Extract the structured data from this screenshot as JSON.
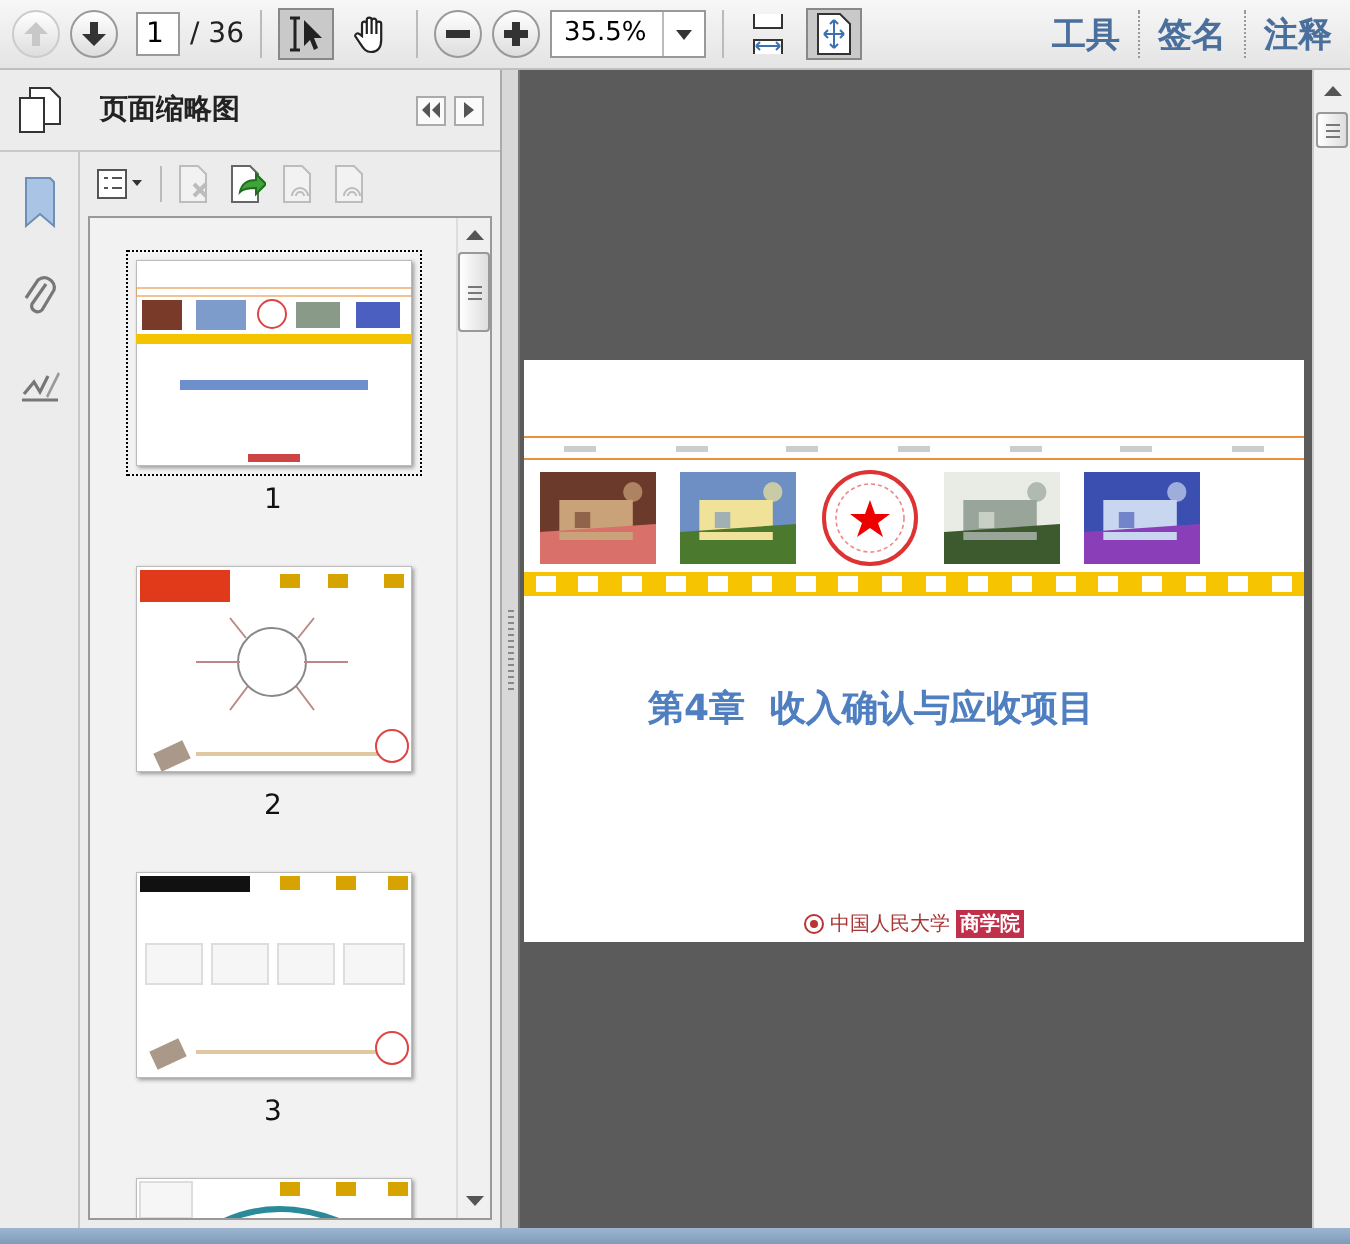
{
  "toolbar": {
    "nav": [
      {
        "kind": "prev",
        "disabled": true
      },
      {
        "kind": "next",
        "disabled": false
      }
    ],
    "page_input": "1",
    "page_total": "/ 36",
    "tools": [
      {
        "kind": "select",
        "selected": true
      },
      {
        "kind": "hand",
        "selected": false
      }
    ],
    "zoom": "35.5%",
    "fit": [
      {
        "kind": "fit-width",
        "selected": false
      },
      {
        "kind": "fit-page",
        "selected": true
      }
    ],
    "panels": [
      "工具",
      "签名",
      "注释"
    ]
  },
  "sidebar": {
    "title": "页面缩略图",
    "tools": [
      {
        "kind": "options",
        "disabled": false
      },
      {
        "kind": "delete",
        "disabled": true
      },
      {
        "kind": "insert",
        "disabled": false
      },
      {
        "kind": "print",
        "disabled": true
      },
      {
        "kind": "embed",
        "disabled": true
      }
    ],
    "thumbnails": [
      {
        "kind": "title",
        "label": "1",
        "selected": true
      },
      {
        "kind": "mindmap",
        "label": "2",
        "selected": false
      },
      {
        "kind": "boxes",
        "label": "3",
        "selected": false
      },
      {
        "kind": "arc",
        "selected": false
      }
    ]
  },
  "page": {
    "title": "第4章  收入确认与应收项目",
    "logo_text": "中国人民大学",
    "logo_badge": "商学院"
  }
}
